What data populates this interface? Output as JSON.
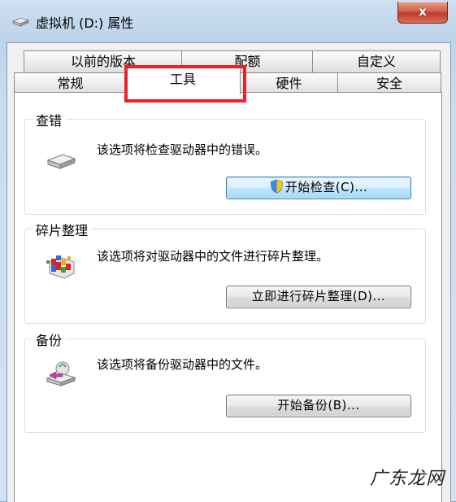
{
  "window": {
    "title": "虚拟机 (D:) 属性",
    "close_label": "x"
  },
  "tabs": {
    "row_back": [
      {
        "label": "以前的版本"
      },
      {
        "label": "配额"
      },
      {
        "label": "自定义"
      }
    ],
    "row_front": [
      {
        "label": "常规"
      },
      {
        "label": "工具"
      },
      {
        "label": "硬件"
      },
      {
        "label": "安全"
      }
    ],
    "active": "工具"
  },
  "groups": {
    "error_check": {
      "title": "查错",
      "desc": "该选项将检查驱动器中的错误。",
      "button": "开始检查(C)...",
      "icon": "drive-icon"
    },
    "defrag": {
      "title": "碎片整理",
      "desc": "该选项将对驱动器中的文件进行碎片整理。",
      "button": "立即进行碎片整理(D)...",
      "icon": "defrag-icon"
    },
    "backup": {
      "title": "备份",
      "desc": "该选项将备份驱动器中的文件。",
      "button": "开始备份(B)...",
      "icon": "backup-icon"
    }
  },
  "annotation": {
    "color": "#e8242a"
  },
  "watermark": "广东龙网"
}
